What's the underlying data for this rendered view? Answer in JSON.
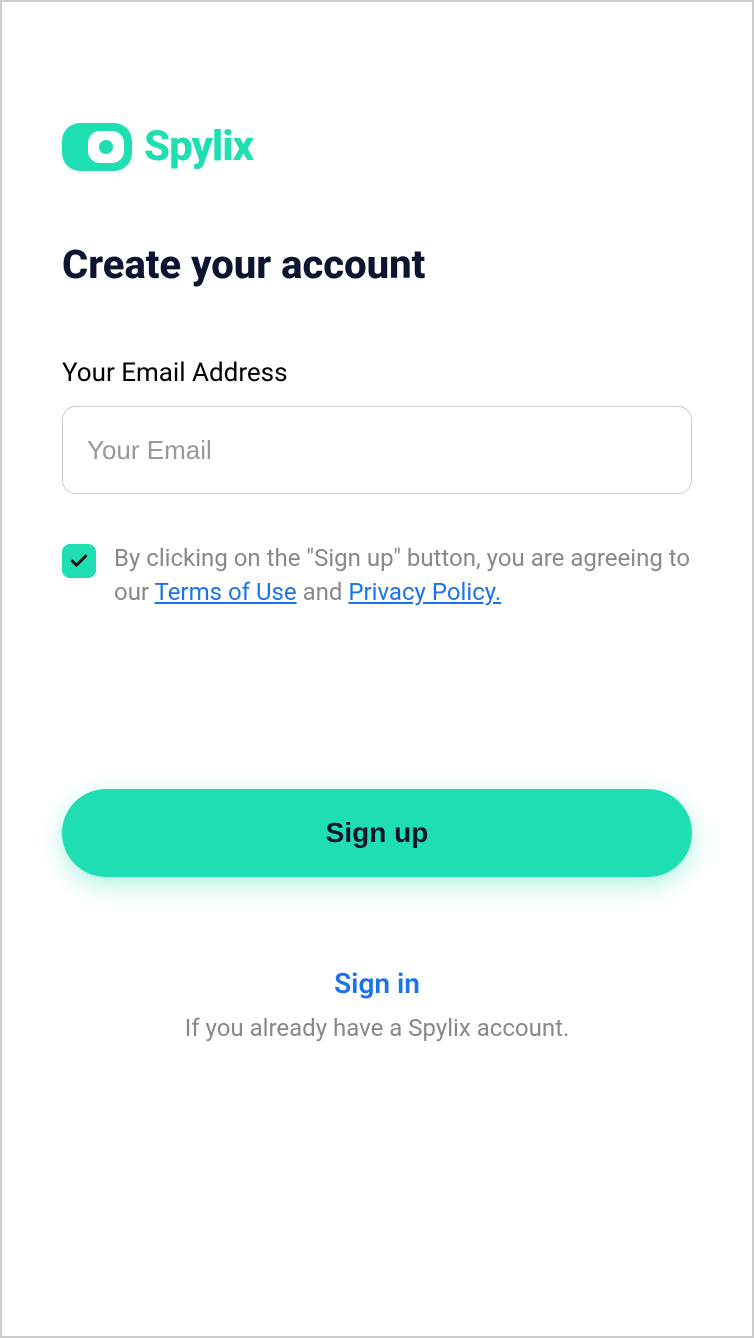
{
  "logo": {
    "brand_name": "Spylix"
  },
  "header": {
    "title": "Create your account"
  },
  "form": {
    "email_label": "Your Email Address",
    "email_placeholder": "Your Email",
    "email_value": ""
  },
  "consent": {
    "checked": true,
    "text_prefix": "By clicking on the \"Sign up\" button, you are agreeing to our ",
    "terms_label": "Terms of Use",
    "text_middle": " and ",
    "privacy_label": "Privacy Policy."
  },
  "actions": {
    "signup_label": "Sign up"
  },
  "footer": {
    "signin_label": "Sign in",
    "already_text": "If you already have a Spylix account."
  }
}
